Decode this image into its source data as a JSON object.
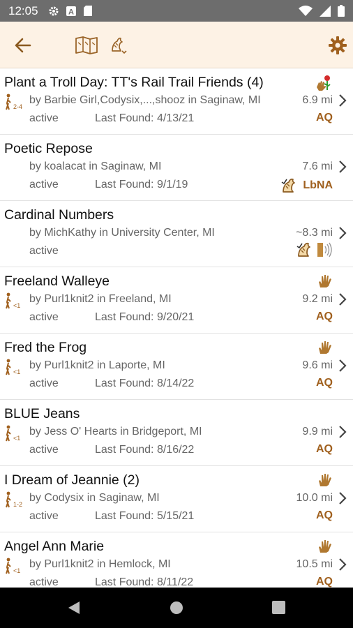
{
  "status_bar": {
    "time": "12:05"
  },
  "toolbar": {
    "back_icon": "arrow-left-icon",
    "map_icon": "map-icon",
    "filter_icon": "letterbox-filter-icon",
    "settings_icon": "gear-icon"
  },
  "colors": {
    "toolbar_bg": "#fdf2e5",
    "accent": "#a0601e",
    "status_bar": "#6d6d6d"
  },
  "boxes": [
    {
      "title": "Plant a Troll Day: TT's Rail Trail Friends (4)",
      "difficulty": "2-4",
      "by": "by Barbie Girl,Codysix,...,shooz in Saginaw, MI",
      "distance": "6.9 mi",
      "status": "active",
      "last_found": "Last Found: 4/13/21",
      "tag": "AQ",
      "top_icon": "hand-flower-icon"
    },
    {
      "title": "Poetic Repose",
      "difficulty": "",
      "by": "by koalacat in Saginaw, MI",
      "distance": "7.6 mi",
      "status": "active",
      "last_found": "Last Found: 9/1/19",
      "tag": "LbNA",
      "top_icon": ""
    },
    {
      "title": "Cardinal Numbers",
      "difficulty": "",
      "by": "by MichKathy in University Center, MI",
      "distance": "~8.3 mi",
      "status": "active",
      "last_found": "",
      "tag": "",
      "top_icon": ""
    },
    {
      "title": "Freeland Walleye",
      "difficulty": "<1",
      "by": "by Purl1knit2 in Freeland, MI",
      "distance": "9.2 mi",
      "status": "active",
      "last_found": "Last Found: 9/20/21",
      "tag": "AQ",
      "top_icon": "hand-icon"
    },
    {
      "title": "Fred the Frog",
      "difficulty": "<1",
      "by": "by Purl1knit2 in Laporte, MI",
      "distance": "9.6 mi",
      "status": "active",
      "last_found": "Last Found: 8/14/22",
      "tag": "AQ",
      "top_icon": "hand-icon"
    },
    {
      "title": "BLUE Jeans",
      "difficulty": "<1",
      "by": "by Jess O' Hearts in Bridgeport, MI",
      "distance": "9.9 mi",
      "status": "active",
      "last_found": "Last Found: 8/16/22",
      "tag": "AQ",
      "top_icon": "hand-icon"
    },
    {
      "title": "I Dream of Jeannie (2)",
      "difficulty": "1-2",
      "by": "by Codysix in Saginaw, MI",
      "distance": "10.0 mi",
      "status": "active",
      "last_found": "Last Found: 5/15/21",
      "tag": "AQ",
      "top_icon": "hand-icon"
    },
    {
      "title": "Angel Ann Marie",
      "difficulty": "<1",
      "by": "by Purl1knit2 in Hemlock, MI",
      "distance": "10.5 mi",
      "status": "active",
      "last_found": "Last Found: 8/11/22",
      "tag": "AQ",
      "top_icon": "hand-icon"
    }
  ],
  "nav_bar": {
    "back": "nav-back-icon",
    "home": "nav-home-icon",
    "recents": "nav-recents-icon"
  }
}
